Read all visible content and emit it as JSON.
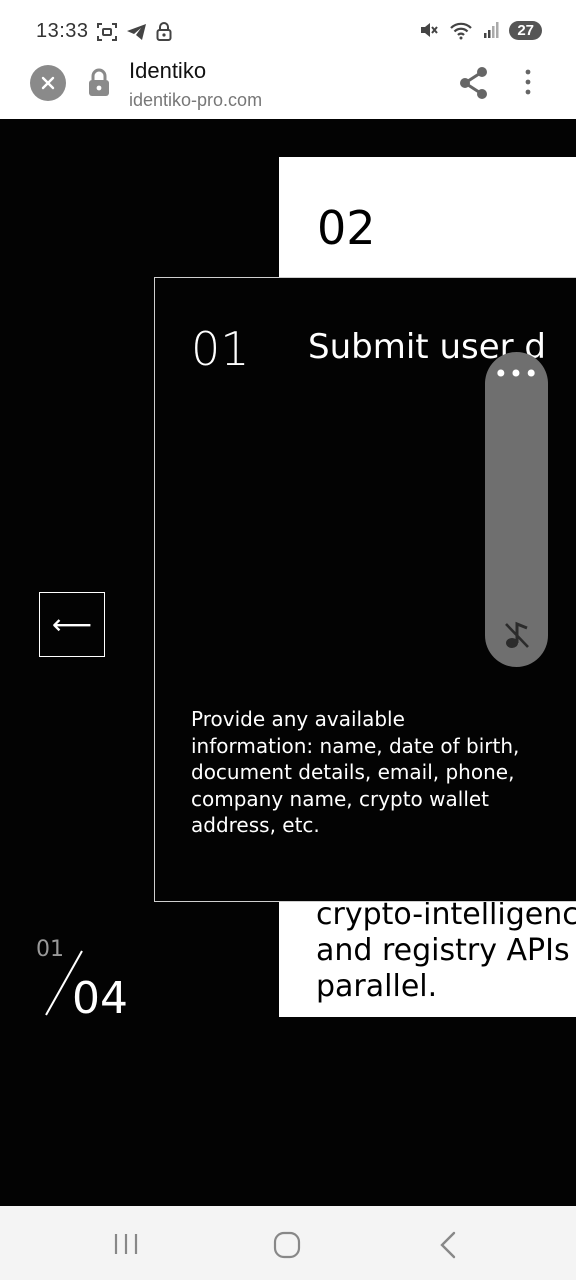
{
  "status_bar": {
    "time": "13:33",
    "battery": "27",
    "icons_left": [
      "screenshot-icon",
      "telegram-icon",
      "lock-icon"
    ],
    "icons_right": [
      "mute-icon",
      "wifi-icon",
      "signal-icon",
      "battery-icon"
    ]
  },
  "browser": {
    "title": "Identiko",
    "url": "identiko-pro.com",
    "icons": [
      "close-icon",
      "lock-icon",
      "share-icon",
      "more-vert-icon"
    ]
  },
  "carousel": {
    "front_card": {
      "number": "01",
      "title": "Submit user d",
      "description": "Provide any available information: name, date of birth, document details, email, phone, company name, crypto wallet address, etc."
    },
    "back_card": {
      "number": "02",
      "text": "crypto-intelligence\nand registry APIs in\nparallel."
    },
    "prev_arrow": "⟵",
    "counter": {
      "current": "01",
      "total": "04"
    }
  },
  "floating_panel": {
    "more": "•••",
    "icons": [
      "more-horiz-icon",
      "mute-note-icon"
    ]
  },
  "nav_bar": {
    "icons": [
      "recent-apps-icon",
      "home-icon",
      "back-icon"
    ]
  },
  "colors": {
    "page_background": "#030303",
    "card_white": "#ffffff",
    "panel_gray": "#6f6f6f",
    "nav_bar": "#f4f4f4"
  }
}
